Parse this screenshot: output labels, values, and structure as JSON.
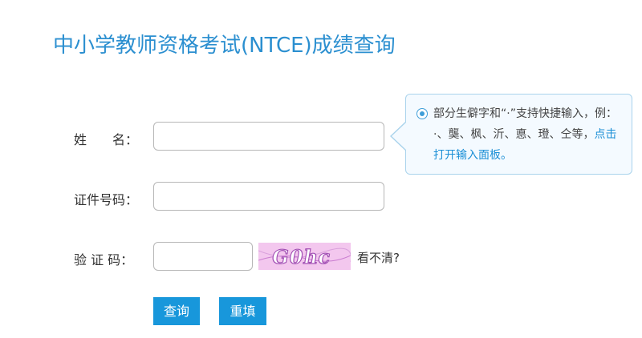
{
  "page": {
    "title": "中小学教师资格考试(NTCE)成绩查询"
  },
  "form": {
    "name_label": "姓　　名：",
    "name_value": "",
    "id_label": "证件号码：",
    "id_value": "",
    "captcha_label": "验 证 码：",
    "captcha_value": "",
    "captcha_image_text": "G0hc",
    "captcha_refresh_label": "看不清?"
  },
  "buttons": {
    "query_label": "查询",
    "reset_label": "重填"
  },
  "tooltip": {
    "text": "部分生僻字和“·”支持快捷输入，例：·、龑、枫、沂、悳、璒、仝等，",
    "link_text": "点击打开输入面板。"
  },
  "colors": {
    "title": "#2b8fd0",
    "button_bg": "#1897db",
    "tooltip_border": "#a9d3ec",
    "tooltip_bg": "#f4faff",
    "link": "#1b8fd6",
    "captcha_bg": "#f3c7ee"
  }
}
